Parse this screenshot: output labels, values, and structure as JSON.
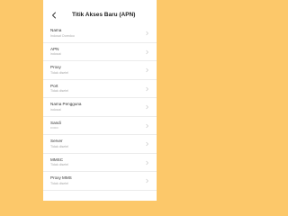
{
  "header": {
    "title": "Titik Akses Baru (APN)"
  },
  "icons": {
    "back": "back-arrow-icon",
    "row_chevron": "chevron-right-icon"
  },
  "colors": {
    "background": "#fcc86a",
    "panel": "#ffffff"
  },
  "settings": {
    "items": [
      {
        "label": "Nama",
        "value": "Indosat Ooredoo"
      },
      {
        "label": "APN",
        "value": "indosat"
      },
      {
        "label": "Proxy",
        "value": "Tidak disetel"
      },
      {
        "label": "Port",
        "value": "Tidak disetel"
      },
      {
        "label": "Nama Pengguna",
        "value": "indosat"
      },
      {
        "label": "Sandi",
        "value": "•••••••"
      },
      {
        "label": "Server",
        "value": "Tidak disetel"
      },
      {
        "label": "MMSC",
        "value": "Tidak disetel"
      },
      {
        "label": "Proxy MMS",
        "value": "Tidak disetel"
      }
    ]
  }
}
